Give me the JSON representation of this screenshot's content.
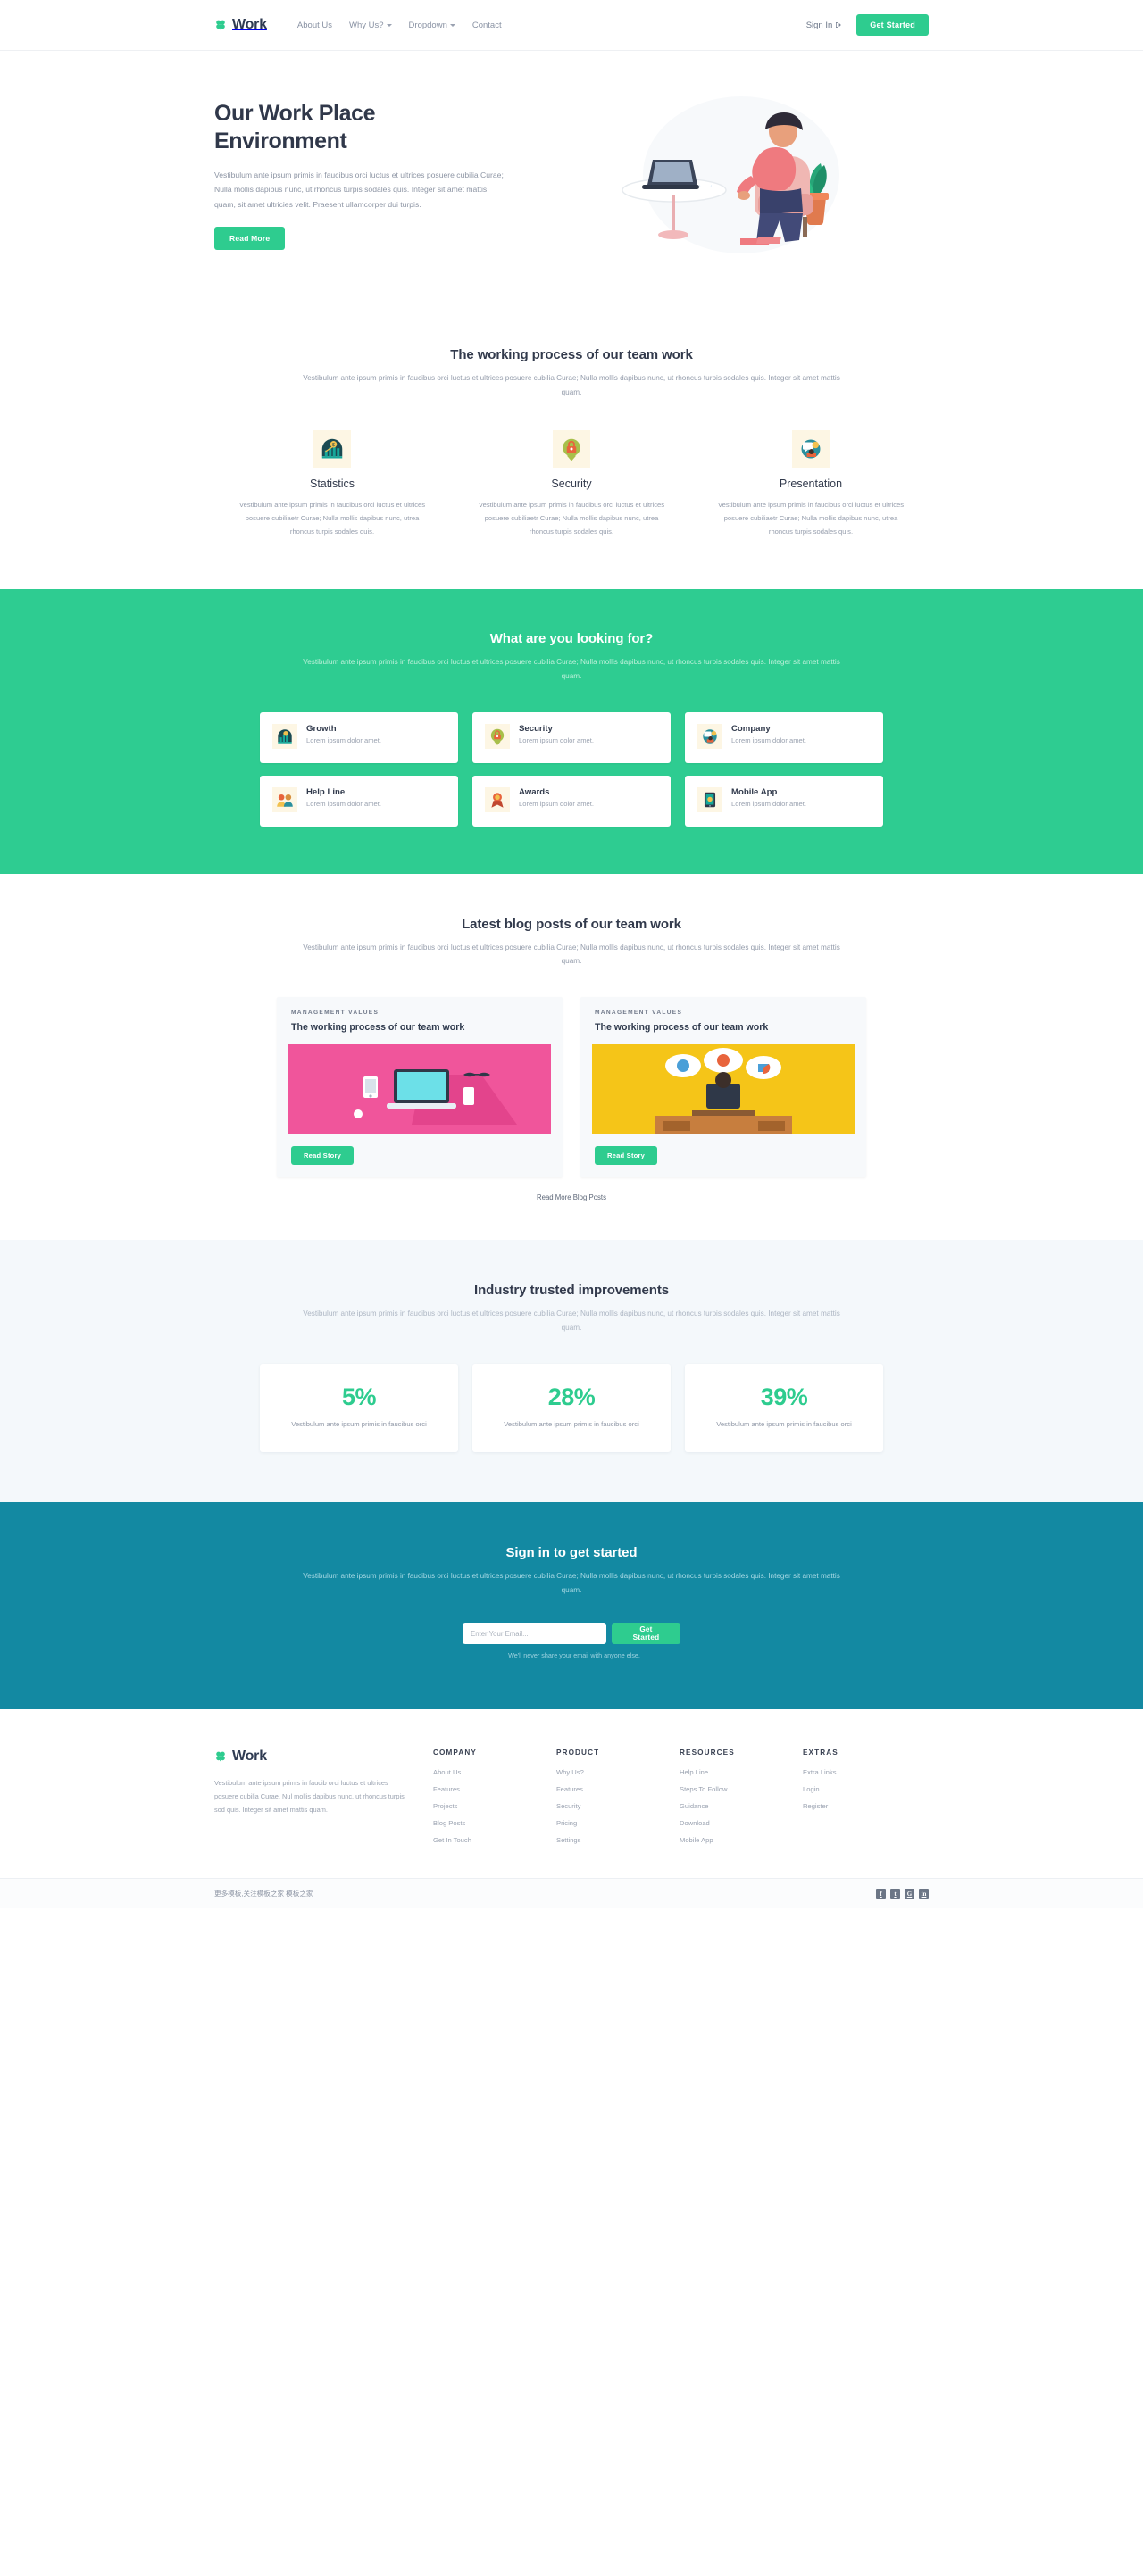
{
  "colors": {
    "green": "#2ecc8f",
    "teal_section": "#2ecc91",
    "dark_teal": "#1389a2",
    "dark_text": "#30384a",
    "muted_text": "#949cab",
    "stats_bg": "#f4f8fb"
  },
  "nav": {
    "brand": "Work",
    "brand_icon": "clover-logo-icon",
    "links": [
      {
        "label": "About Us",
        "caret": false
      },
      {
        "label": "Why Us?",
        "caret": true
      },
      {
        "label": "Dropdown",
        "caret": true
      },
      {
        "label": "Contact",
        "caret": false
      }
    ],
    "signin_label": "Sign In",
    "signin_icon": "sign-in-arrow-icon",
    "cta_label": "Get Started"
  },
  "hero": {
    "title": "Our Work Place Environment",
    "paragraph": "Vestibulum ante ipsum primis in faucibus orci luctus et ultrices posuere cubilia Curae; Nulla mollis dapibus nunc, ut rhoncus turpis sodales quis. Integer sit amet mattis quam, sit amet ultricies velit. Praesent ullamcorper dui turpis.",
    "button_label": "Read More",
    "illustration": "woman-working-on-laptop-illustration"
  },
  "process": {
    "title": "The working process of our team work",
    "subtitle": "Vestibulum ante ipsum primis in faucibus orci luctus et ultrices posuere cubilia Curae; Nulla mollis dapibus nunc, ut rhoncus turpis sodales quis. Integer sit amet mattis quam.",
    "columns": [
      {
        "icon": "statistics-growth-chart-icon",
        "title": "Statistics",
        "text": "Vestibulum ante ipsum primis in faucibus orci luctus et ultrices posuere cubiliaetr Curae; Nulla mollis dapibus nunc, utrea rhoncus turpis sodales quis."
      },
      {
        "icon": "security-padlock-icon",
        "title": "Security",
        "text": "Vestibulum ante ipsum primis in faucibus orci luctus et ultrices posuere cubiliaetr Curae; Nulla mollis dapibus nunc, utrea rhoncus turpis sodales quis."
      },
      {
        "icon": "presentation-speech-bubble-icon",
        "title": "Presentation",
        "text": "Vestibulum ante ipsum primis in faucibus orci luctus et ultrices posuere cubiliaetr Curae; Nulla mollis dapibus nunc, utrea rhoncus turpis sodales quis."
      }
    ]
  },
  "looking_for": {
    "title": "What are you looking for?",
    "subtitle": "Vestibulum ante ipsum primis in faucibus orci luctus et ultrices posuere cubilia Curae; Nulla mollis dapibus nunc, ut rhoncus turpis sodales quis. Integer sit amet mattis quam.",
    "cards": [
      {
        "icon": "growth-chart-icon",
        "title": "Growth",
        "text": "Lorem ipsum dolor amet."
      },
      {
        "icon": "security-padlock-icon",
        "title": "Security",
        "text": "Lorem ipsum dolor amet."
      },
      {
        "icon": "company-presentation-icon",
        "title": "Company",
        "text": "Lorem ipsum dolor amet."
      },
      {
        "icon": "help-line-people-icon",
        "title": "Help Line",
        "text": "Lorem ipsum dolor amet."
      },
      {
        "icon": "awards-trophy-icon",
        "title": "Awards",
        "text": "Lorem ipsum dolor amet."
      },
      {
        "icon": "mobile-app-icon",
        "title": "Mobile App",
        "text": "Lorem ipsum dolor amet."
      }
    ]
  },
  "blog": {
    "title": "Latest blog posts of our team work",
    "subtitle": "Vestibulum ante ipsum primis in faucibus orci luctus et ultrices posuere cubilia Curae; Nulla mollis dapibus nunc, ut rhoncus turpis sodales quis. Integer sit amet mattis quam.",
    "posts": [
      {
        "kicker": "MANAGEMENT VALUES",
        "title": "The working process of our team work",
        "image": "pink-laptop-desk-illustration",
        "button_label": "Read Story"
      },
      {
        "kicker": "MANAGEMENT VALUES",
        "title": "The working process of our team work",
        "image": "yellow-person-at-desk-illustration",
        "button_label": "Read Story"
      }
    ],
    "more_link_label": "Read More Blog Posts"
  },
  "stats": {
    "title": "Industry trusted improvements",
    "subtitle": "Vestibulum ante ipsum primis in faucibus orci luctus et ultrices posuere cubilia Curae; Nulla mollis dapibus nunc, ut rhoncus turpis sodales quis. Integer sit amet mattis quam.",
    "cards": [
      {
        "value": "5%",
        "text": "Vestibulum ante ipsum primis in faucibus orci"
      },
      {
        "value": "28%",
        "text": "Vestibulum ante ipsum primis in faucibus orci"
      },
      {
        "value": "39%",
        "text": "Vestibulum ante ipsum primis in faucibus orci"
      }
    ]
  },
  "signup": {
    "title": "Sign in to get started",
    "subtitle": "Vestibulum ante ipsum primis in faucibus orci luctus et ultrices posuere cubilia Curae; Nulla mollis dapibus nunc, ut rhoncus turpis sodales quis. Integer sit amet mattis quam.",
    "email_placeholder": "Enter Your Email...",
    "email_value": "",
    "button_label": "Get Started",
    "disclaimer": "We'll never share your email with anyone else."
  },
  "footer": {
    "brand": "Work",
    "brand_icon": "clover-logo-icon",
    "description": "Vestibulum ante ipsum primis in faucib orci luctus et ultrices posuere cubilia Curae, Nul mollis dapibus nunc, ut rhoncus turpis sod quis. Integer sit amet mattis quam.",
    "columns": [
      {
        "heading": "COMPANY",
        "links": [
          "About Us",
          "Features",
          "Projects",
          "Blog Posts",
          "Get In Touch"
        ]
      },
      {
        "heading": "PRODUCT",
        "links": [
          "Why Us?",
          "Features",
          "Security",
          "Pricing",
          "Settings"
        ]
      },
      {
        "heading": "RESOURCES",
        "links": [
          "Help Line",
          "Steps To Follow",
          "Guidance",
          "Download",
          "Mobile App"
        ]
      },
      {
        "heading": "EXTRAS",
        "links": [
          "Extra Links",
          "Login",
          "Register"
        ]
      }
    ]
  },
  "bottombar": {
    "text": "更多模板,关注模板之家 模板之家",
    "social": [
      {
        "icon": "facebook-icon",
        "glyph": "f"
      },
      {
        "icon": "twitter-icon",
        "glyph": "t"
      },
      {
        "icon": "google-plus-icon",
        "glyph": "G"
      },
      {
        "icon": "linkedin-icon",
        "glyph": "in"
      }
    ]
  }
}
